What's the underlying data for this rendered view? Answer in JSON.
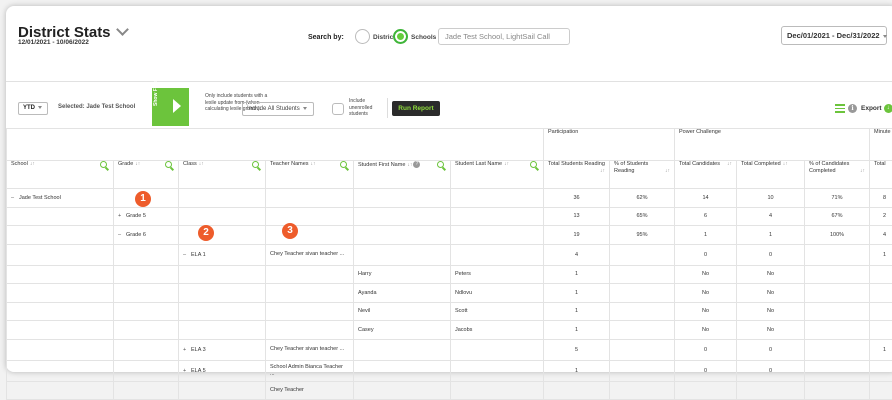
{
  "header": {
    "title": "District Stats",
    "date_subtitle": "12/01/2021 - 10/06/2022",
    "search_by_label": "Search by:",
    "search_options": [
      "Districts",
      "Schools"
    ],
    "search_selected": "Schools",
    "school_field_value": "Jade Test School, LightSail Call",
    "date_range": "Dec/01/2021 - Dec/31/2022"
  },
  "filters": {
    "period": "YTD",
    "selected_label": "Selected: Jade Test School",
    "show_filters_label": "Show Filters",
    "lexile_note": "Only include students with a lexile update from (when calculating lexile growth):",
    "students_select": "Include All Students",
    "unenrolled_label": "Include unenrolled students",
    "run_report": "Run Report",
    "export_label": "Export"
  },
  "table": {
    "groups": [
      "Participation",
      "Power Challenge",
      "Minute"
    ],
    "columns": [
      "School",
      "Grade",
      "Class",
      "Teacher Names",
      "Student First Name",
      "Student Last Name",
      "Total Students Reading",
      "% of Students Reading",
      "Total Candidates",
      "Total Completed",
      "% of Candidates Completed",
      "Total"
    ],
    "rows": [
      {
        "exp": "–",
        "school": "Jade Test School",
        "grade": "",
        "cls": "",
        "teacher": "",
        "first": "",
        "last": "",
        "tsr": "36",
        "psr": "62%",
        "tc": "14",
        "tcomp": "10",
        "pcc": "71%",
        "min": "8"
      },
      {
        "exp": "+",
        "school": "",
        "grade": "Grade 5",
        "cls": "",
        "teacher": "",
        "first": "",
        "last": "",
        "tsr": "13",
        "psr": "65%",
        "tc": "6",
        "tcomp": "4",
        "pcc": "67%",
        "min": "2"
      },
      {
        "exp": "–",
        "school": "",
        "grade": "Grade 6",
        "cls": "",
        "teacher": "",
        "first": "",
        "last": "",
        "tsr": "19",
        "psr": "95%",
        "tc": "1",
        "tcomp": "1",
        "pcc": "100%",
        "min": "4"
      },
      {
        "exp": "–",
        "school": "",
        "grade": "",
        "cls": "ELA 1",
        "teacher": "Chey Teacher sivan teacher ...",
        "first": "",
        "last": "",
        "tsr": "4",
        "psr": "",
        "tc": "0",
        "tcomp": "0",
        "pcc": "",
        "min": "1"
      },
      {
        "exp": "",
        "school": "",
        "grade": "",
        "cls": "",
        "teacher": "",
        "first": "Harry",
        "last": "Peters",
        "tsr": "1",
        "psr": "",
        "tc": "No",
        "tcomp": "No",
        "pcc": "",
        "min": ""
      },
      {
        "exp": "",
        "school": "",
        "grade": "",
        "cls": "",
        "teacher": "",
        "first": "Ayanda",
        "last": "Ndlovu",
        "tsr": "1",
        "psr": "",
        "tc": "No",
        "tcomp": "No",
        "pcc": "",
        "min": ""
      },
      {
        "exp": "",
        "school": "",
        "grade": "",
        "cls": "",
        "teacher": "",
        "first": "Nevil",
        "last": "Scott",
        "tsr": "1",
        "psr": "",
        "tc": "No",
        "tcomp": "No",
        "pcc": "",
        "min": ""
      },
      {
        "exp": "",
        "school": "",
        "grade": "",
        "cls": "",
        "teacher": "",
        "first": "Casey",
        "last": "Jacobs",
        "tsr": "1",
        "psr": "",
        "tc": "No",
        "tcomp": "No",
        "pcc": "",
        "min": ""
      },
      {
        "exp": "+",
        "school": "",
        "grade": "",
        "cls": "ELA 3",
        "teacher": "Chey Teacher sivan teacher ...",
        "first": "",
        "last": "",
        "tsr": "5",
        "psr": "",
        "tc": "0",
        "tcomp": "0",
        "pcc": "",
        "min": "1"
      },
      {
        "exp": "+",
        "school": "",
        "grade": "",
        "cls": "ELA 5",
        "teacher": "School Admin Bianca Teacher ...",
        "first": "",
        "last": "",
        "tsr": "1",
        "psr": "",
        "tc": "0",
        "tcomp": "0",
        "pcc": "",
        "min": ""
      },
      {
        "exp": "",
        "school": "",
        "grade": "",
        "cls": "",
        "teacher": "Chey Teacher",
        "first": "",
        "last": "",
        "tsr": "",
        "psr": "",
        "tc": "",
        "tcomp": "",
        "pcc": "",
        "min": ""
      }
    ]
  },
  "annotations": [
    "1",
    "2",
    "3"
  ]
}
